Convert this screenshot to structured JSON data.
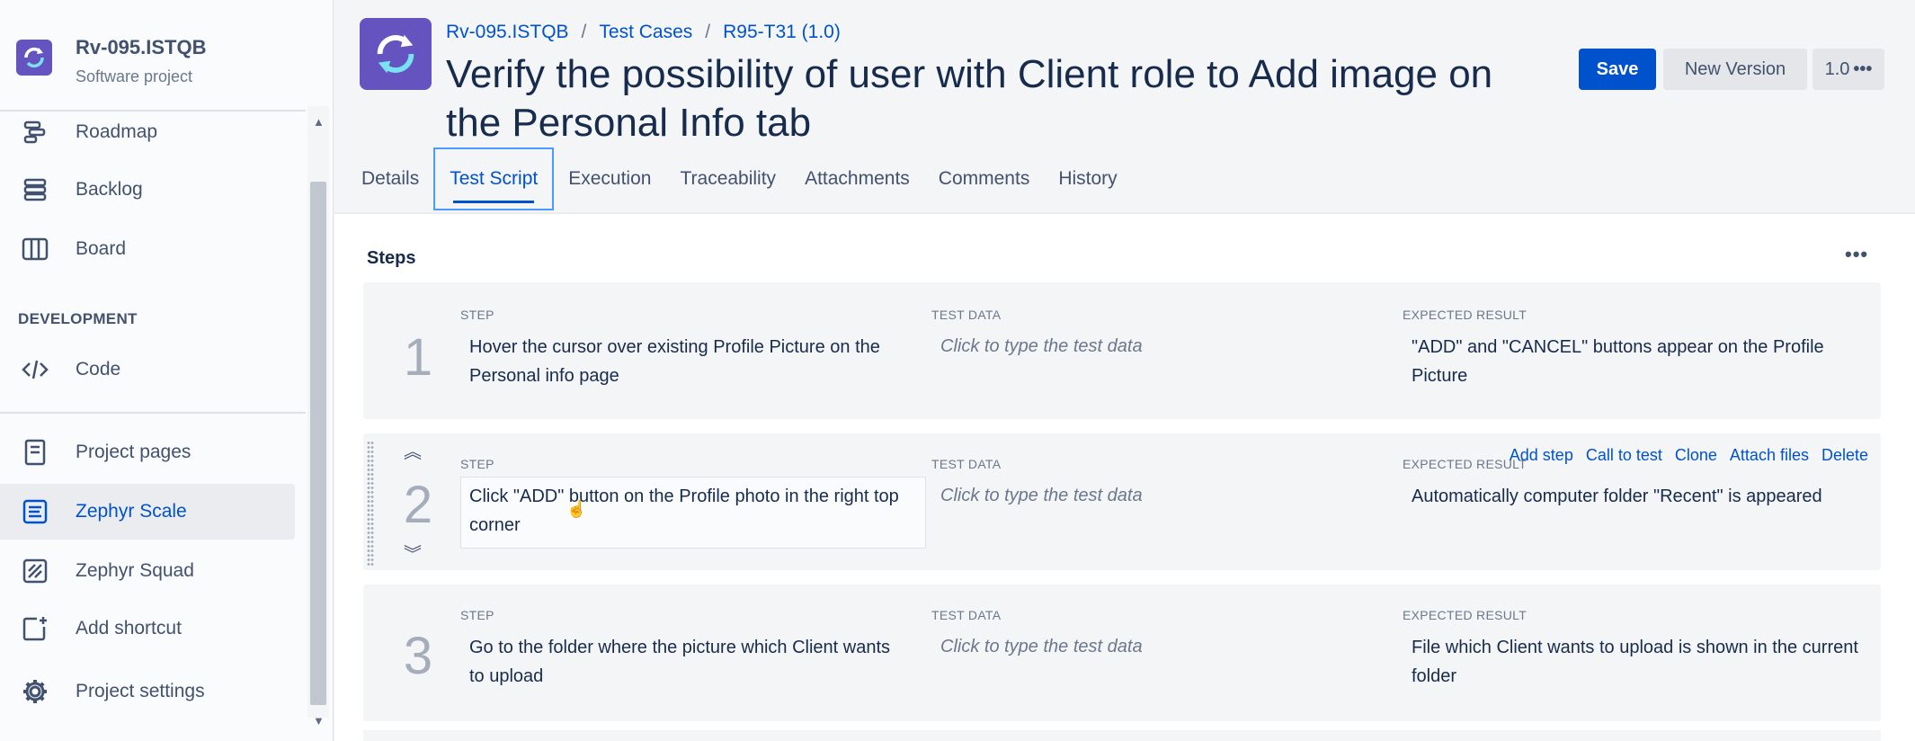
{
  "project": {
    "name": "Rv-095.ISTQB",
    "type": "Software project"
  },
  "sidebar": {
    "items": [
      {
        "label": "Roadmap",
        "icon": "roadmap-icon"
      },
      {
        "label": "Backlog",
        "icon": "backlog-icon"
      },
      {
        "label": "Board",
        "icon": "board-icon"
      }
    ],
    "section_heading": "DEVELOPMENT",
    "dev_items": [
      {
        "label": "Code",
        "icon": "code-icon"
      }
    ],
    "bottom_items": [
      {
        "label": "Project pages",
        "icon": "page-icon"
      },
      {
        "label": "Zephyr Scale",
        "icon": "zephyr-scale-icon",
        "active": true
      },
      {
        "label": "Zephyr Squad",
        "icon": "zephyr-squad-icon"
      },
      {
        "label": "Add shortcut",
        "icon": "add-shortcut-icon"
      },
      {
        "label": "Project settings",
        "icon": "gear-icon"
      }
    ]
  },
  "breadcrumb": [
    "Rv-095.ISTQB",
    "Test Cases",
    "R95-T31 (1.0)"
  ],
  "breadcrumb_separator": "/",
  "title": "Verify the possibility of user with Client role to Add image on the Personal Info tab",
  "buttons": {
    "save": "Save",
    "new_version": "New Version",
    "version": "1.0"
  },
  "tabs": [
    "Details",
    "Test Script",
    "Execution",
    "Traceability",
    "Attachments",
    "Comments",
    "History"
  ],
  "active_tab": "Test Script",
  "steps_section": {
    "label": "Steps",
    "more": "•••"
  },
  "column_labels": {
    "step": "STEP",
    "test_data": "TEST DATA",
    "expected": "EXPECTED RESULT"
  },
  "test_data_placeholder": "Click to type the test data",
  "step_actions": [
    "Add step",
    "Call to test",
    "Clone",
    "Attach files",
    "Delete"
  ],
  "steps": [
    {
      "number": "1",
      "step": "Hover the cursor over existing Profile Picture on the Personal info page",
      "expected": "\"ADD\" and \"CANCEL\" buttons appear on the Profile Picture"
    },
    {
      "number": "2",
      "step": "Click \"ADD\" button on the Profile photo in the right top corner",
      "expected": "Automatically computer folder \"Recent\" is appeared"
    },
    {
      "number": "3",
      "step": "Go to the folder where the picture which Client wants to upload",
      "expected": "File which Client wants to upload is shown in the current folder"
    }
  ],
  "colors": {
    "accent": "#0052cc",
    "brand": "#6554c0",
    "text": "#172b4d"
  }
}
